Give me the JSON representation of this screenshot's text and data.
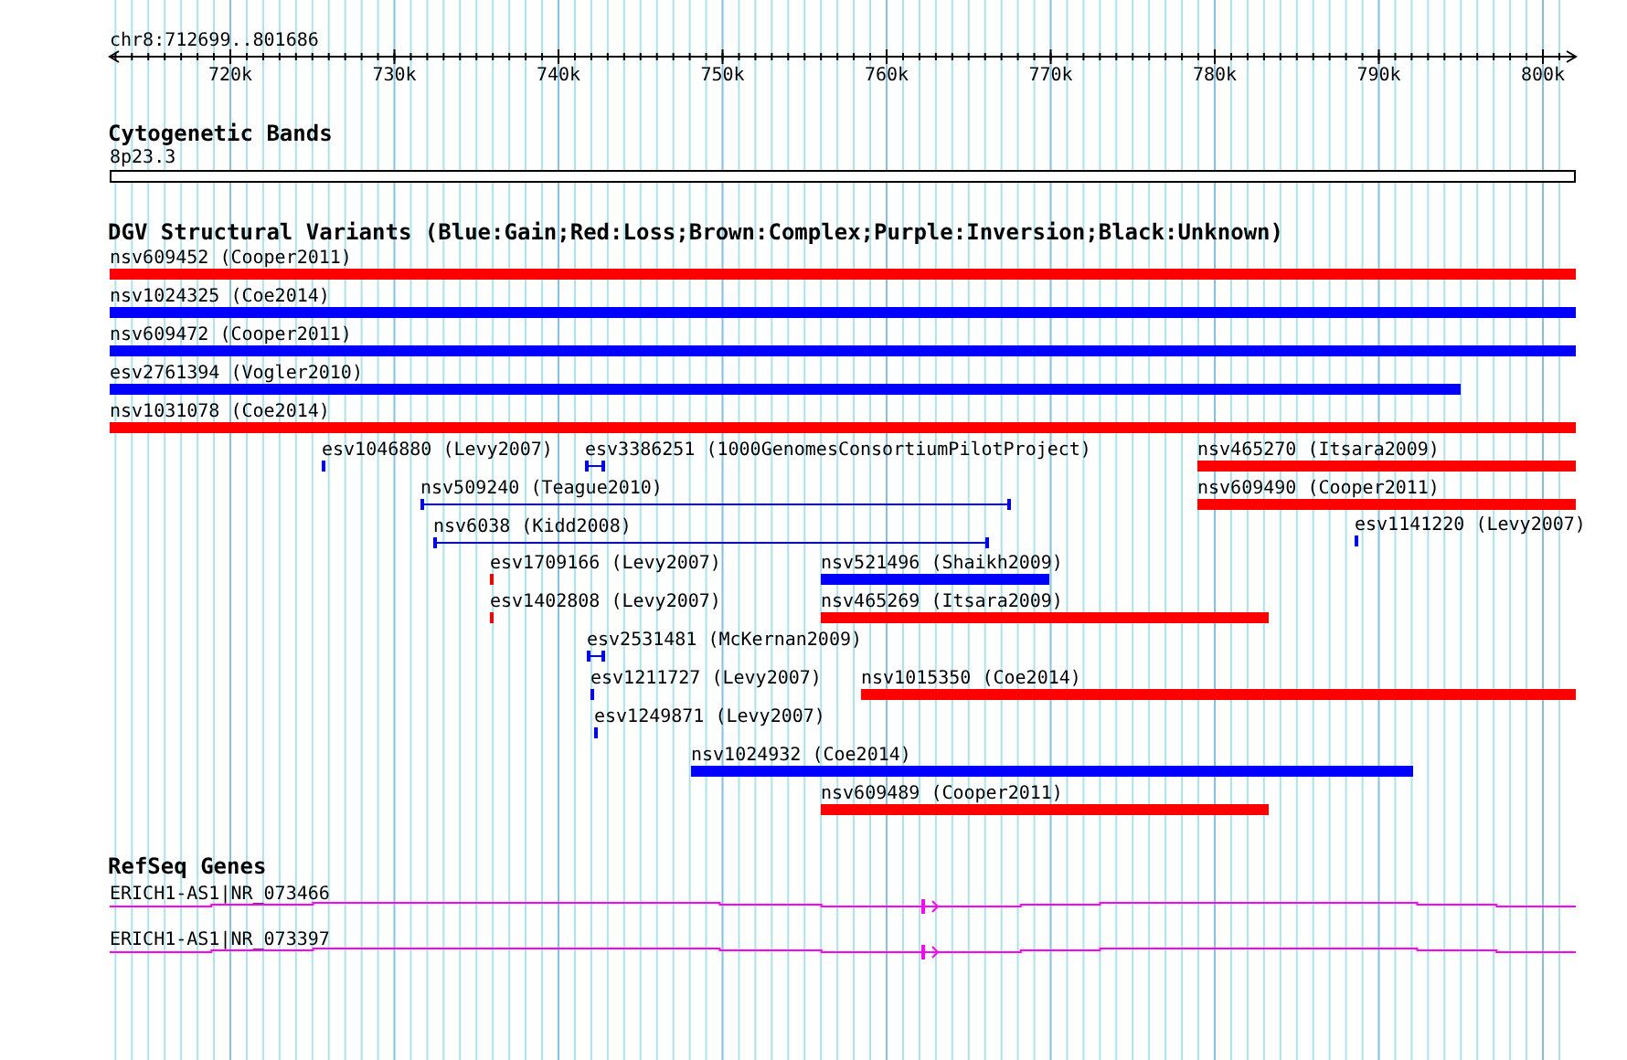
{
  "ruler": {
    "location": "chr8:712699..801686",
    "ticks": [
      "720k",
      "730k",
      "740k",
      "750k",
      "760k",
      "770k",
      "780k",
      "790k",
      "800k"
    ]
  },
  "tracks": [
    {
      "title": "Cytogenetic Bands",
      "kind": "bands",
      "features": [
        {
          "label": "8p23.3"
        }
      ]
    },
    {
      "title": "DGV Structural Variants (Blue:Gain;Red:Loss;Brown:Complex;Purple:Inversion;Black:Unknown)",
      "kind": "variants",
      "features": [
        {
          "label": "nsv609452 (Cooper2011)",
          "color": "#ff0000",
          "kind": "bar"
        },
        {
          "label": "nsv1024325 (Coe2014)",
          "color": "#0000ff",
          "kind": "bar"
        },
        {
          "label": "nsv609472 (Cooper2011)",
          "color": "#0000ff",
          "kind": "bar"
        },
        {
          "label": "esv2761394 (Vogler2010)",
          "color": "#0000ff",
          "kind": "bar"
        },
        {
          "label": "nsv1031078 (Coe2014)",
          "color": "#ff0000",
          "kind": "bar"
        },
        {
          "label": "esv1046880 (Levy2007)",
          "color": "#0000ff",
          "kind": "bar"
        },
        {
          "label": "esv3386251 (1000GenomesConsortiumPilotProject)",
          "color": "#0000ff",
          "kind": "span"
        },
        {
          "label": "nsv465270 (Itsara2009)",
          "color": "#ff0000",
          "kind": "bar"
        },
        {
          "label": "nsv509240 (Teague2010)",
          "color": "#0000ff",
          "kind": "span"
        },
        {
          "label": "nsv609490 (Cooper2011)",
          "color": "#ff0000",
          "kind": "bar"
        },
        {
          "label": "nsv6038 (Kidd2008)",
          "color": "#0000ff",
          "kind": "span"
        },
        {
          "label": "esv1141220 (Levy2007)",
          "color": "#0000ff",
          "kind": "bar"
        },
        {
          "label": "esv1709166 (Levy2007)",
          "color": "#ff0000",
          "kind": "bar"
        },
        {
          "label": "nsv521496 (Shaikh2009)",
          "color": "#0000ff",
          "kind": "bar"
        },
        {
          "label": "esv1402808 (Levy2007)",
          "color": "#ff0000",
          "kind": "bar"
        },
        {
          "label": "nsv465269 (Itsara2009)",
          "color": "#ff0000",
          "kind": "bar"
        },
        {
          "label": "esv2531481 (McKernan2009)",
          "color": "#0000ff",
          "kind": "span"
        },
        {
          "label": "esv1211727 (Levy2007)",
          "color": "#0000ff",
          "kind": "bar"
        },
        {
          "label": "nsv1015350 (Coe2014)",
          "color": "#ff0000",
          "kind": "bar"
        },
        {
          "label": "esv1249871 (Levy2007)",
          "color": "#0000ff",
          "kind": "bar"
        },
        {
          "label": "nsv1024932 (Coe2014)",
          "color": "#0000ff",
          "kind": "bar"
        },
        {
          "label": "nsv609489 (Cooper2011)",
          "color": "#ff0000",
          "kind": "bar"
        }
      ]
    },
    {
      "title": "RefSeq Genes",
      "kind": "genes",
      "features": [
        {
          "label": "ERICH1-AS1|NR_073466"
        },
        {
          "label": "ERICH1-AS1|NR_073397"
        }
      ]
    }
  ]
}
